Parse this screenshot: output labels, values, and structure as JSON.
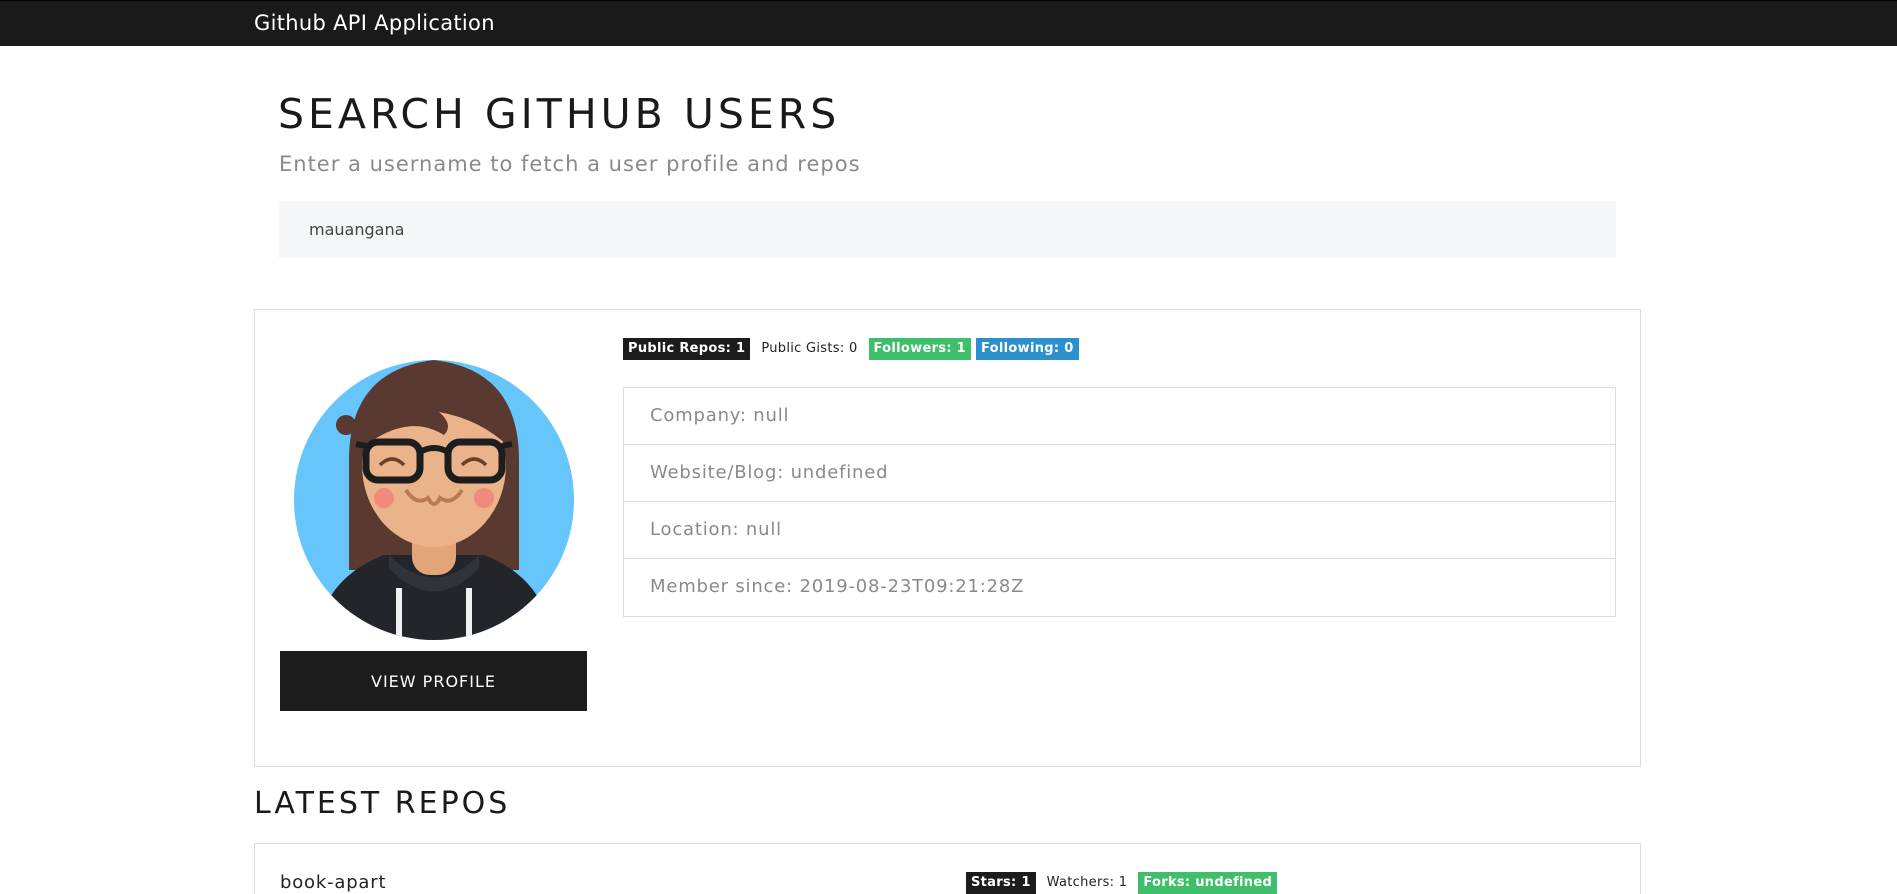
{
  "navbar": {
    "brand": "Github API Application"
  },
  "search": {
    "title": "SEARCH GITHUB USERS",
    "subtitle": "Enter a username to fetch a user profile and repos",
    "value": "mauangana"
  },
  "profile": {
    "view_profile_label": "VIEW PROFILE",
    "badges": {
      "public_repos": "Public Repos: 1",
      "public_gists": "Public Gists: 0",
      "followers": "Followers: 1",
      "following": "Following: 0"
    },
    "info": {
      "company": "Company: null",
      "website": "Website/Blog: undefined",
      "location": "Location: null",
      "member_since": "Member since: 2019-08-23T09:21:28Z"
    }
  },
  "repos": {
    "heading": "LATEST REPOS",
    "items": [
      {
        "name": "book-apart",
        "stars": "Stars: 1",
        "watchers": "Watchers: 1",
        "forks": "Forks: undefined"
      }
    ]
  },
  "colors": {
    "navbar": "#1a1a1a",
    "badge_dark": "#1c1c1c",
    "badge_green": "#3fbf6b",
    "badge_blue": "#2b90cc",
    "avatar_bg": "#66c6fb"
  }
}
